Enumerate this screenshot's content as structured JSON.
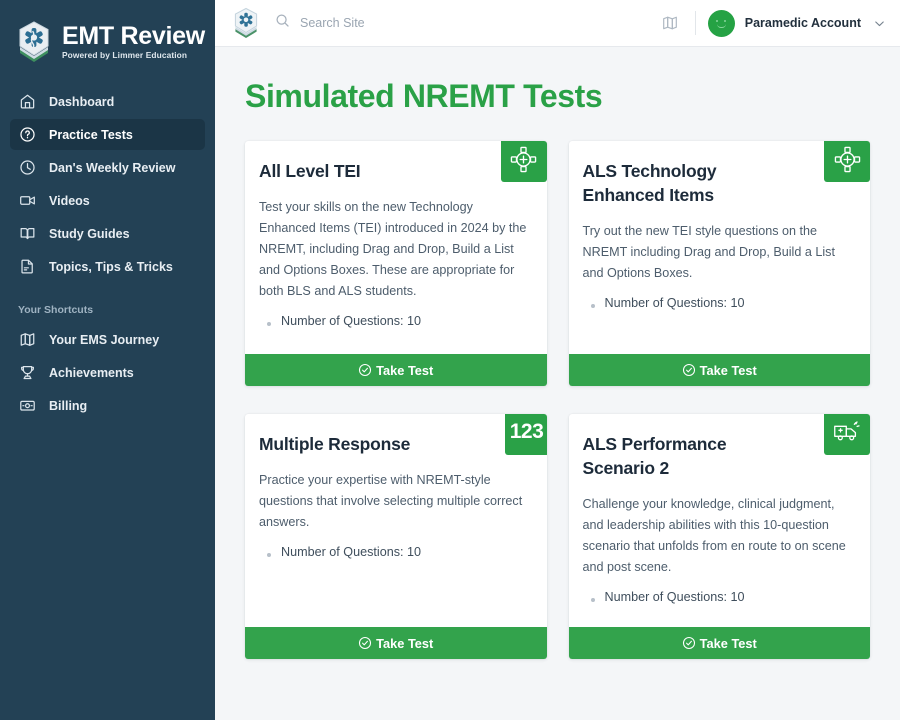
{
  "sidebar": {
    "brand": {
      "title": "EMT Review",
      "subtitle": "Powered by Limmer Education",
      "logo_icon": "star-of-life-shield-icon"
    },
    "items": [
      {
        "label": "Dashboard",
        "icon": "home-icon",
        "active": false
      },
      {
        "label": "Practice Tests",
        "icon": "question-circle-icon",
        "active": true
      },
      {
        "label": "Dan's Weekly Review",
        "icon": "clock-icon",
        "active": false
      },
      {
        "label": "Videos",
        "icon": "video-camera-icon",
        "active": false
      },
      {
        "label": "Study Guides",
        "icon": "open-book-icon",
        "active": false
      },
      {
        "label": "Topics, Tips & Tricks",
        "icon": "document-icon",
        "active": false
      }
    ],
    "shortcuts_label": "Your Shortcuts",
    "shortcuts": [
      {
        "label": "Your EMS Journey",
        "icon": "map-icon"
      },
      {
        "label": "Achievements",
        "icon": "trophy-icon"
      },
      {
        "label": "Billing",
        "icon": "payment-card-icon"
      }
    ]
  },
  "topbar": {
    "logo_icon": "star-of-life-shield-icon",
    "search": {
      "icon": "search-icon",
      "placeholder": "Search Site",
      "value": ""
    },
    "map_icon": "map-icon",
    "account": {
      "name": "Paramedic Account",
      "avatar_icon": "smiley-avatar-icon",
      "caret_icon": "chevron-down-icon"
    }
  },
  "main": {
    "title": "Simulated NREMT Tests",
    "cards": [
      {
        "title": "All Level TEI",
        "description": "Test your skills on the new Technology Enhanced Items (TEI) introduced in 2024 by the NREMT, including Drag and Drop, Build a List and Options Boxes. These are appropriate for both BLS and ALS students.",
        "meta": "Number of Questions: 10",
        "badge_icon": "drag-handles-plus-icon",
        "badge_text": "",
        "button_label": "Take Test",
        "button_icon": "check-circle-icon"
      },
      {
        "title": "ALS Technology Enhanced Items",
        "description": "Try out the new TEI style questions on the NREMT including Drag and Drop, Build a List and Options Boxes.",
        "meta": "Number of Questions: 10",
        "badge_icon": "drag-handles-plus-icon",
        "badge_text": "",
        "button_label": "Take Test",
        "button_icon": "check-circle-icon"
      },
      {
        "title": "Multiple Response",
        "description": "Practice your expertise with NREMT-style questions that involve selecting multiple correct answers.",
        "meta": "Number of Questions: 10",
        "badge_icon": "",
        "badge_text": "123",
        "button_label": "Take Test",
        "button_icon": "check-circle-icon"
      },
      {
        "title": "ALS Performance Scenario 2",
        "description": "Challenge your knowledge, clinical judgment, and leadership abilities with this 10-question scenario that unfolds from en route to on scene and post scene.",
        "meta": "Number of Questions: 10",
        "badge_icon": "ambulance-icon",
        "badge_text": "",
        "button_label": "Take Test",
        "button_icon": "check-circle-icon"
      }
    ]
  },
  "colors": {
    "sidebar_bg": "#234155",
    "sidebar_active": "#1b3546",
    "accent_green": "#2aa147",
    "button_green": "#33a34c",
    "page_bg": "#f4f6f8",
    "title_green": "#2aa147"
  }
}
